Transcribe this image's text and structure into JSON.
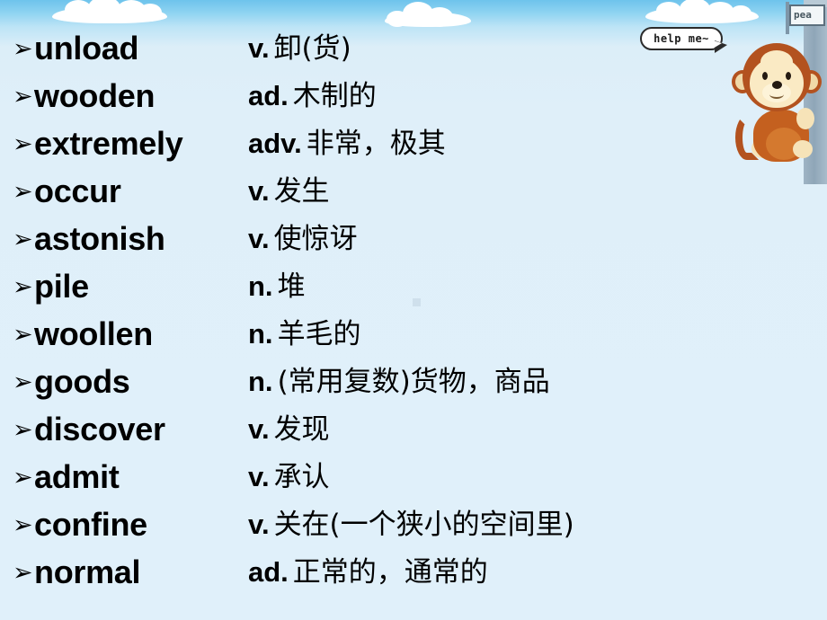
{
  "slide": {
    "background_top_color": "#6ec3ec",
    "background_bottom_color": "#e0f0fa",
    "cliff_color": "#8fa6b8"
  },
  "decorations": {
    "sign_text": "pea",
    "bubble_text": "help me~",
    "monkey_label": "monkey-mascot",
    "cloud_count": 3
  },
  "vocabulary": [
    {
      "term": "unload",
      "pos": "v.",
      "meaning": "卸(货)"
    },
    {
      "term": "wooden",
      "pos": "ad.",
      "meaning": "木制的"
    },
    {
      "term": "extremely",
      "pos": "adv.",
      "meaning": "非常，极其"
    },
    {
      "term": "occur",
      "pos": "v.",
      "meaning": "发生"
    },
    {
      "term": "astonish",
      "pos": "v.",
      "meaning": "使惊讶"
    },
    {
      "term": "pile",
      "pos": "n.",
      "meaning": "堆"
    },
    {
      "term": "woollen",
      "pos": "n.",
      "meaning": "羊毛的"
    },
    {
      "term": "goods",
      "pos": "n.",
      "meaning": "(常用复数)货物，商品"
    },
    {
      "term": "discover",
      "pos": "v.",
      "meaning": "发现"
    },
    {
      "term": "admit",
      "pos": "v.",
      "meaning": "承认"
    },
    {
      "term": "confine",
      "pos": "v.",
      "meaning": "关在(一个狭小的空间里)"
    },
    {
      "term": "normal",
      "pos": "ad.",
      "meaning": "正常的，通常的"
    }
  ],
  "bullet_glyph": "➢"
}
